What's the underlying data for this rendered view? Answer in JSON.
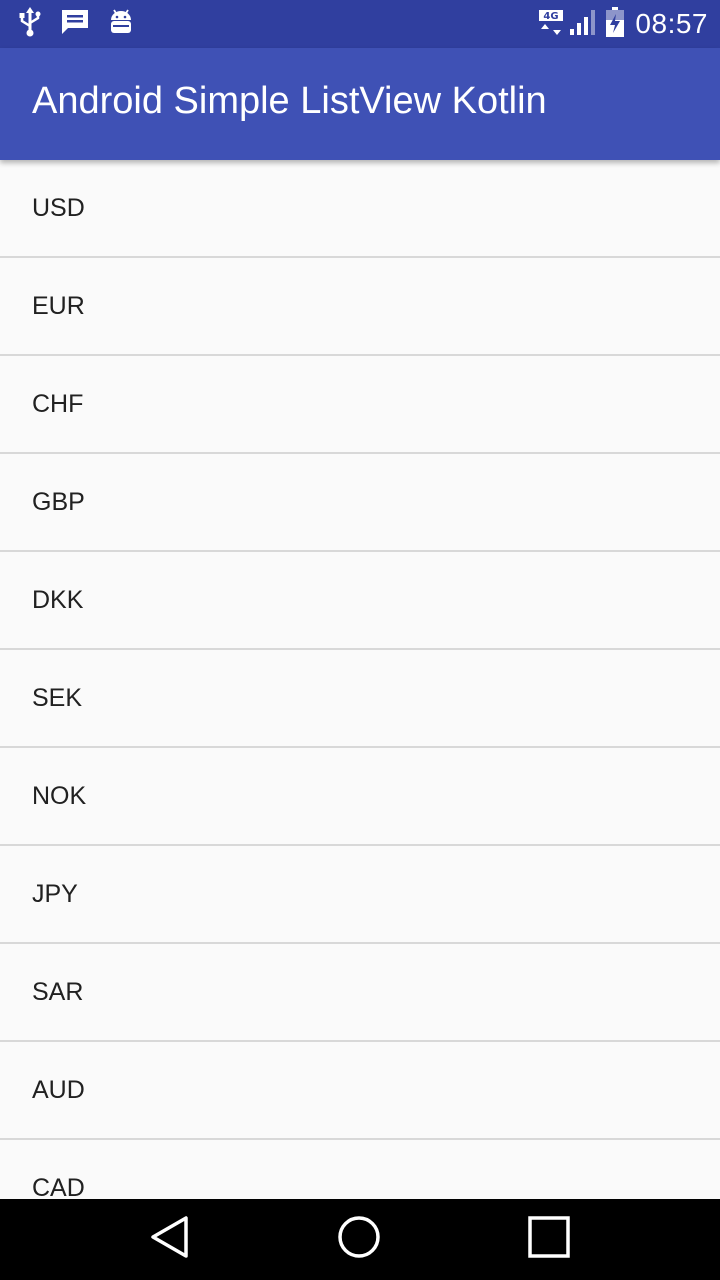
{
  "status_bar": {
    "time": "08:57",
    "network_type": "4G",
    "icons": [
      "usb-icon",
      "message-icon",
      "android-icon",
      "network-4g-icon",
      "signal-icon",
      "battery-charging-icon"
    ]
  },
  "app_bar": {
    "title": "Android Simple ListView Kotlin",
    "color": "#3f51b5"
  },
  "list": {
    "items": [
      "USD",
      "EUR",
      "CHF",
      "GBP",
      "DKK",
      "SEK",
      "NOK",
      "JPY",
      "SAR",
      "AUD",
      "CAD"
    ]
  },
  "nav_bar": {
    "icons": [
      "back-icon",
      "home-icon",
      "recents-icon"
    ]
  }
}
